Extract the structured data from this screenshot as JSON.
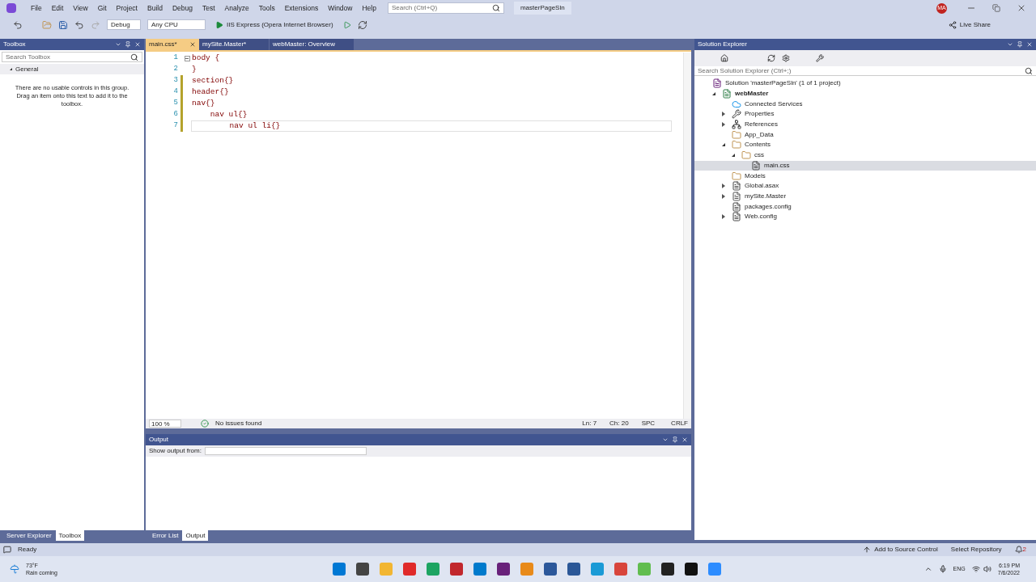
{
  "menu": [
    "File",
    "Edit",
    "View",
    "Git",
    "Project",
    "Build",
    "Debug",
    "Test",
    "Analyze",
    "Tools",
    "Extensions",
    "Window",
    "Help"
  ],
  "search": {
    "placeholder": "Search (Ctrl+Q)"
  },
  "solution_name": "masterPageSln",
  "avatar": "MA",
  "toolbar": {
    "configuration": "Debug",
    "platform": "Any CPU",
    "run_target": "IIS Express (Opera Internet Browser)",
    "live_share": "Live Share"
  },
  "toolbox": {
    "title": "Toolbox",
    "search_placeholder": "Search Toolbox",
    "group": {
      "label": "General",
      "expanded": true
    },
    "message": "There are no usable controls in this group. Drag an item onto this text to add it to the toolbox."
  },
  "editor_tabs": [
    {
      "label": "main.css*",
      "selected": true
    },
    {
      "label": "mySite.Master*",
      "selected": false
    },
    {
      "label": "webMaster: Overview",
      "selected": false
    }
  ],
  "code_lines": [
    {
      "number": "1",
      "text": "body {",
      "modified": false,
      "fold": true,
      "current": false
    },
    {
      "number": "2",
      "text": "}",
      "modified": false,
      "fold": false,
      "current": false
    },
    {
      "number": "3",
      "text": "section{}",
      "modified": true,
      "fold": false,
      "current": false
    },
    {
      "number": "4",
      "text": "header{}",
      "modified": true,
      "fold": false,
      "current": false
    },
    {
      "number": "5",
      "text": "nav{}",
      "modified": true,
      "fold": false,
      "current": false
    },
    {
      "number": "6",
      "text": "    nav ul{}",
      "modified": true,
      "fold": false,
      "current": false
    },
    {
      "number": "7",
      "text": "        nav ul li{}",
      "modified": true,
      "fold": false,
      "current": true
    }
  ],
  "editor_status": {
    "zoom": "100 %",
    "issues": "No issues found",
    "line": "Ln: 7",
    "column": "Ch: 20",
    "whitespace": "SPC",
    "line_ending": "CRLF"
  },
  "output": {
    "title": "Output",
    "source_label": "Show output from:"
  },
  "left_tabs": [
    {
      "label": "Server Explorer",
      "selected": false
    },
    {
      "label": "Toolbox",
      "selected": true
    }
  ],
  "bottom_tabs": [
    {
      "label": "Error List",
      "selected": false
    },
    {
      "label": "Output",
      "selected": true
    }
  ],
  "solution_explorer": {
    "title": "Solution Explorer",
    "search_placeholder": "Search Solution Explorer (Ctrl+;)",
    "tree": [
      {
        "label": "Solution 'masterPageSln' (1 of 1 project)",
        "kind": "solution",
        "selected": false,
        "children": [
          {
            "label": "webMaster",
            "kind": "project",
            "selected": false,
            "expanded": true,
            "children": [
              {
                "label": "Connected Services",
                "kind": "cloud",
                "selected": false
              },
              {
                "label": "Properties",
                "kind": "wrench",
                "selected": false,
                "expanded": false
              },
              {
                "label": "References",
                "kind": "refs",
                "selected": false,
                "expanded": false
              },
              {
                "label": "App_Data",
                "kind": "folder",
                "selected": false
              },
              {
                "label": "Contents",
                "kind": "folder",
                "selected": false,
                "expanded": true,
                "children": [
                  {
                    "label": "css",
                    "kind": "folder",
                    "selected": false,
                    "expanded": true,
                    "children": [
                      {
                        "label": "main.css",
                        "kind": "file",
                        "selected": true
                      }
                    ]
                  }
                ]
              },
              {
                "label": "Models",
                "kind": "folder",
                "selected": false
              },
              {
                "label": "Global.asax",
                "kind": "file",
                "selected": false,
                "expanded": false
              },
              {
                "label": "mySite.Master",
                "kind": "page",
                "selected": false,
                "expanded": false
              },
              {
                "label": "packages.config",
                "kind": "file",
                "selected": false
              },
              {
                "label": "Web.config",
                "kind": "file",
                "selected": false,
                "expanded": false
              }
            ]
          }
        ]
      }
    ]
  },
  "status_bar": {
    "text": "Ready",
    "source_control": "Add to Source Control",
    "repository": "Select Repository",
    "notifications": "2"
  },
  "taskbar": {
    "temperature": "73°F",
    "weather": "Rain coming",
    "language": "ENG",
    "time": "6:19 PM",
    "date": "7/6/2022"
  }
}
